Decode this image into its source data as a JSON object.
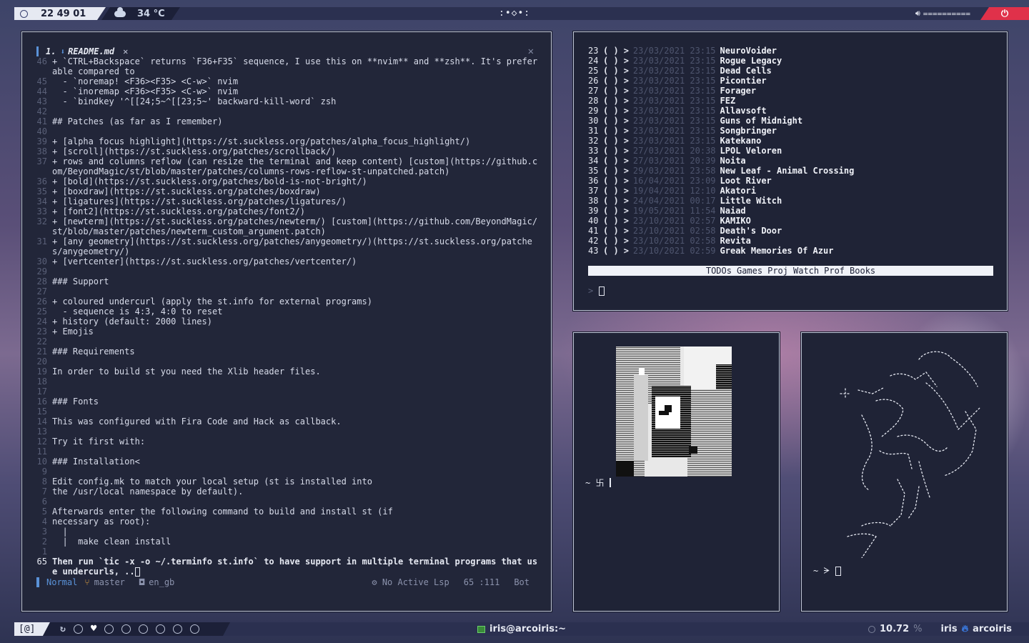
{
  "topbar": {
    "clock": "22 49 01",
    "temperature": "34 °C",
    "workspace_indicator": ":•◇•:",
    "volume_bar": "==========",
    "power_icon": "power-icon"
  },
  "editor": {
    "tab_number": "1.",
    "file_name": "README.md",
    "lines": [
      {
        "n": "46",
        "t": "+ `CTRL+Backspace` returns `F36+F35` sequence, I use this on **nvim** and **zsh**. It's preferable compared to"
      },
      {
        "n": "45",
        "t": "  - `noremap! <F36><F35> <C-w>` nvim"
      },
      {
        "n": "44",
        "t": "  - `inoremap <F36><F35> <C-w>` nvim"
      },
      {
        "n": "43",
        "t": "  - `bindkey '^[[24;5~^[[23;5~' backward-kill-word` zsh"
      },
      {
        "n": "42",
        "t": ""
      },
      {
        "n": "41",
        "t": "## Patches (as far as I remember)"
      },
      {
        "n": "40",
        "t": ""
      },
      {
        "n": "39",
        "t": "+ [alpha focus highlight](https://st.suckless.org/patches/alpha_focus_highlight/)"
      },
      {
        "n": "38",
        "t": "+ [scroll](https://st.suckless.org/patches/scrollback/)"
      },
      {
        "n": "37",
        "t": "+ rows and columns reflow (can resize the terminal and keep content) [custom](https://github.com/BeyondMagic/st/blob/master/patches/columns-rows-reflow-st-unpatched.patch)"
      },
      {
        "n": "36",
        "t": "+ [bold](https://st.suckless.org/patches/bold-is-not-bright/)"
      },
      {
        "n": "35",
        "t": "+ [boxdraw](https://st.suckless.org/patches/boxdraw)"
      },
      {
        "n": "34",
        "t": "+ [ligatures](https://st.suckless.org/patches/ligatures/)"
      },
      {
        "n": "33",
        "t": "+ [font2](https://st.suckless.org/patches/font2/)"
      },
      {
        "n": "32",
        "t": "+ [newterm](https://st.suckless.org/patches/newterm/) [custom](https://github.com/BeyondMagic/st/blob/master/patches/newterm_custom_argument.patch)"
      },
      {
        "n": "31",
        "t": "+ [any geometry](https://st.suckless.org/patches/anygeometry/)(https://st.suckless.org/patches/anygeometry/)"
      },
      {
        "n": "30",
        "t": "+ [vertcenter](https://st.suckless.org/patches/vertcenter/)"
      },
      {
        "n": "29",
        "t": ""
      },
      {
        "n": "28",
        "t": "### Support"
      },
      {
        "n": "27",
        "t": ""
      },
      {
        "n": "26",
        "t": "+ coloured undercurl (apply the st.info for external programs)"
      },
      {
        "n": "25",
        "t": "  - sequence is 4:3, 4:0 to reset"
      },
      {
        "n": "24",
        "t": "+ history (default: 2000 lines)"
      },
      {
        "n": "23",
        "t": "+ Emojis"
      },
      {
        "n": "22",
        "t": ""
      },
      {
        "n": "21",
        "t": "### Requirements"
      },
      {
        "n": "20",
        "t": ""
      },
      {
        "n": "19",
        "t": "In order to build st you need the Xlib header files."
      },
      {
        "n": "18",
        "t": ""
      },
      {
        "n": "17",
        "t": ""
      },
      {
        "n": "16",
        "t": "### Fonts"
      },
      {
        "n": "15",
        "t": ""
      },
      {
        "n": "14",
        "t": "This was configured with Fira Code and Hack as callback."
      },
      {
        "n": "13",
        "t": ""
      },
      {
        "n": "12",
        "t": "Try it first with:"
      },
      {
        "n": "11",
        "t": ""
      },
      {
        "n": "10",
        "t": "### Installation<"
      },
      {
        "n": "9",
        "t": ""
      },
      {
        "n": "8",
        "t": "Edit config.mk to match your local setup (st is installed into"
      },
      {
        "n": "7",
        "t": "the /usr/local namespace by default)."
      },
      {
        "n": "6",
        "t": ""
      },
      {
        "n": "5",
        "t": "Afterwards enter the following command to build and install st (if"
      },
      {
        "n": "4",
        "t": "necessary as root):"
      },
      {
        "n": "3",
        "t": "  |"
      },
      {
        "n": "2",
        "t": "  |  make clean install"
      },
      {
        "n": "1",
        "t": ""
      },
      {
        "n": "65",
        "t": "Then run `tic -x -o ~/.terminfo st.info` to have support in multiple terminal programs that use undercurls, .."
      }
    ],
    "status": {
      "mode": "Normal",
      "branch": "master",
      "spell": "en_gb",
      "lsp": "No Active Lsp",
      "position": "65 :111",
      "scroll": "Bot"
    }
  },
  "games_list": {
    "rows": [
      {
        "idx": "23",
        "date": "23/03/2021 23:15",
        "name": "NeuroVoider"
      },
      {
        "idx": "24",
        "date": "23/03/2021 23:15",
        "name": "Rogue Legacy"
      },
      {
        "idx": "25",
        "date": "23/03/2021 23:15",
        "name": "Dead Cells"
      },
      {
        "idx": "26",
        "date": "23/03/2021 23:15",
        "name": "Picontier"
      },
      {
        "idx": "27",
        "date": "23/03/2021 23:15",
        "name": "Forager"
      },
      {
        "idx": "28",
        "date": "23/03/2021 23:15",
        "name": "FEZ"
      },
      {
        "idx": "29",
        "date": "23/03/2021 23:15",
        "name": "Allavsoft"
      },
      {
        "idx": "30",
        "date": "23/03/2021 23:15",
        "name": "Guns of Midnight"
      },
      {
        "idx": "31",
        "date": "23/03/2021 23:15",
        "name": "Songbringer"
      },
      {
        "idx": "32",
        "date": "23/03/2021 23:15",
        "name": "Katekano"
      },
      {
        "idx": "33",
        "date": "27/03/2021 20:38",
        "name": "LPOL Veloren"
      },
      {
        "idx": "34",
        "date": "27/03/2021 20:39",
        "name": "Noita"
      },
      {
        "idx": "35",
        "date": "29/03/2021 23:58",
        "name": "New Leaf - Animal Crossing"
      },
      {
        "idx": "36",
        "date": "16/04/2021 23:09",
        "name": "Loot River"
      },
      {
        "idx": "37",
        "date": "19/04/2021 12:10",
        "name": "Akatori"
      },
      {
        "idx": "38",
        "date": "24/04/2021 00:17",
        "name": "Little Witch"
      },
      {
        "idx": "39",
        "date": "19/05/2021 11:54",
        "name": "Naiad"
      },
      {
        "idx": "40",
        "date": "23/10/2021 02:57",
        "name": "KAMIKO"
      },
      {
        "idx": "41",
        "date": "23/10/2021 02:58",
        "name": "Death's Door"
      },
      {
        "idx": "42",
        "date": "23/10/2021 02:58",
        "name": "Revita"
      },
      {
        "idx": "43",
        "date": "23/10/2021 02:59",
        "name": "Greak Memories Of Azur"
      }
    ],
    "checkbox": "( )",
    "arrow": ">",
    "tabs": [
      "TODOs",
      "Games",
      "Proj",
      "Watch",
      "Prof",
      "Books"
    ],
    "prompt": ">"
  },
  "art1": {
    "prompt": "~ 卐"
  },
  "art2": {
    "prompt": "~ ᗒ"
  },
  "bottombar": {
    "tag": "[@]",
    "window_title": "iris@arcoiris:~",
    "cpu_value": "10.72",
    "cpu_unit": "%",
    "user": "iris",
    "host": "arcoiris"
  }
}
